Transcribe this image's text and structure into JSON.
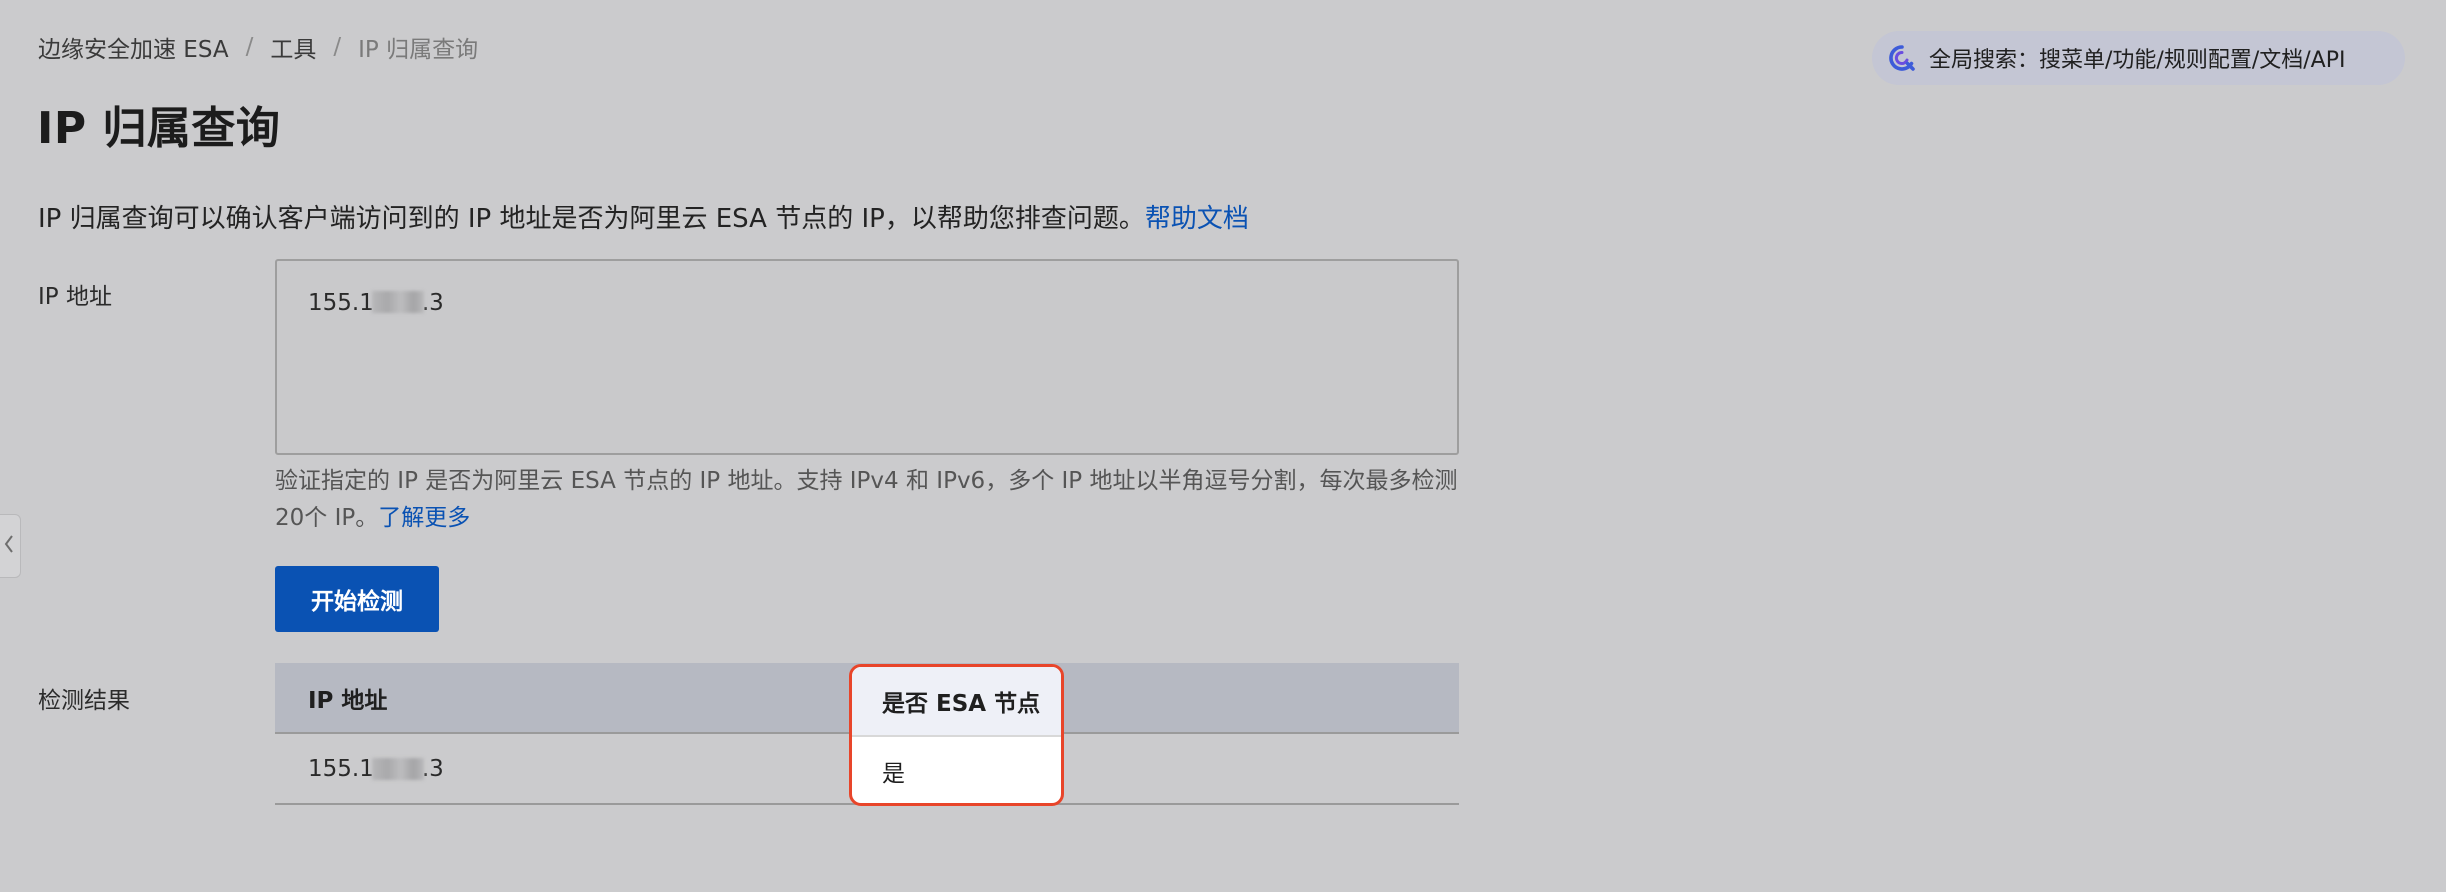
{
  "breadcrumb": {
    "items": [
      "边缘安全加速 ESA",
      "工具",
      "IP 归属查询"
    ],
    "separator": "/"
  },
  "global_search": {
    "label": "全局搜索：搜菜单/功能/规则配置/文档/API",
    "icon": "search-icon"
  },
  "page": {
    "title": "IP 归属查询",
    "description": "IP 归属查询可以确认客户端访问到的 IP 地址是否为阿里云 ESA 节点的 IP，以帮助您排查问题。",
    "help_link": "帮助文档"
  },
  "form": {
    "ip_label": "IP 地址",
    "ip_value_prefix": "155.1",
    "ip_value_suffix": ".3",
    "help_text": "验证指定的 IP 是否为阿里云 ESA 节点的 IP 地址。支持 IPv4 和 IPv6，多个 IP 地址以半角逗号分割，每次最多检测20个 IP。",
    "learn_more": "了解更多",
    "submit_label": "开始检测"
  },
  "results": {
    "label": "检测结果",
    "columns": [
      "IP 地址",
      "是否 ESA 节点"
    ],
    "rows": [
      {
        "ip_prefix": "155.1",
        "ip_suffix": ".3",
        "is_esa": "是"
      }
    ]
  },
  "colors": {
    "primary": "#0a52b3",
    "highlight_border": "#e8452a",
    "overlay_background": "#cbcbcd"
  }
}
